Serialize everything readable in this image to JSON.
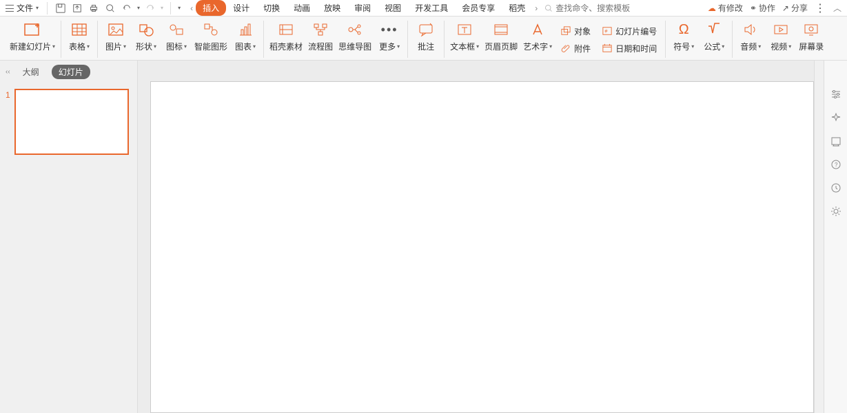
{
  "topbar": {
    "file_label": "文件",
    "search_placeholder": "查找命令、搜索模板",
    "pending_label": "有修改",
    "collab_label": "协作",
    "share_label": "分享"
  },
  "menu_tabs": {
    "left_arrow": "‹",
    "insert": "插入",
    "design": "设计",
    "transition": "切换",
    "animation": "动画",
    "slideshow": "放映",
    "review": "审阅",
    "view": "视图",
    "devtools": "开发工具",
    "membership": "会员专享",
    "docer": "稻壳",
    "right_arrow": "›"
  },
  "ribbon": {
    "new_slide": "新建幻灯片",
    "table": "表格",
    "picture": "图片",
    "shape": "形状",
    "icon": "图标",
    "smartart": "智能图形",
    "chart": "图表",
    "docer_material": "稻壳素材",
    "flowchart": "流程图",
    "mindmap": "思维导图",
    "more": "更多",
    "comment": "批注",
    "textbox": "文本框",
    "header_footer": "页眉页脚",
    "wordart": "艺术字",
    "object": "对象",
    "slide_number": "幻灯片编号",
    "attachment": "附件",
    "datetime": "日期和时间",
    "symbol": "符号",
    "equation": "公式",
    "audio": "音频",
    "video": "视频",
    "screen_rec": "屏幕录"
  },
  "sidebar": {
    "outline": "大纲",
    "slides": "幻灯片",
    "thumb_number": "1"
  }
}
